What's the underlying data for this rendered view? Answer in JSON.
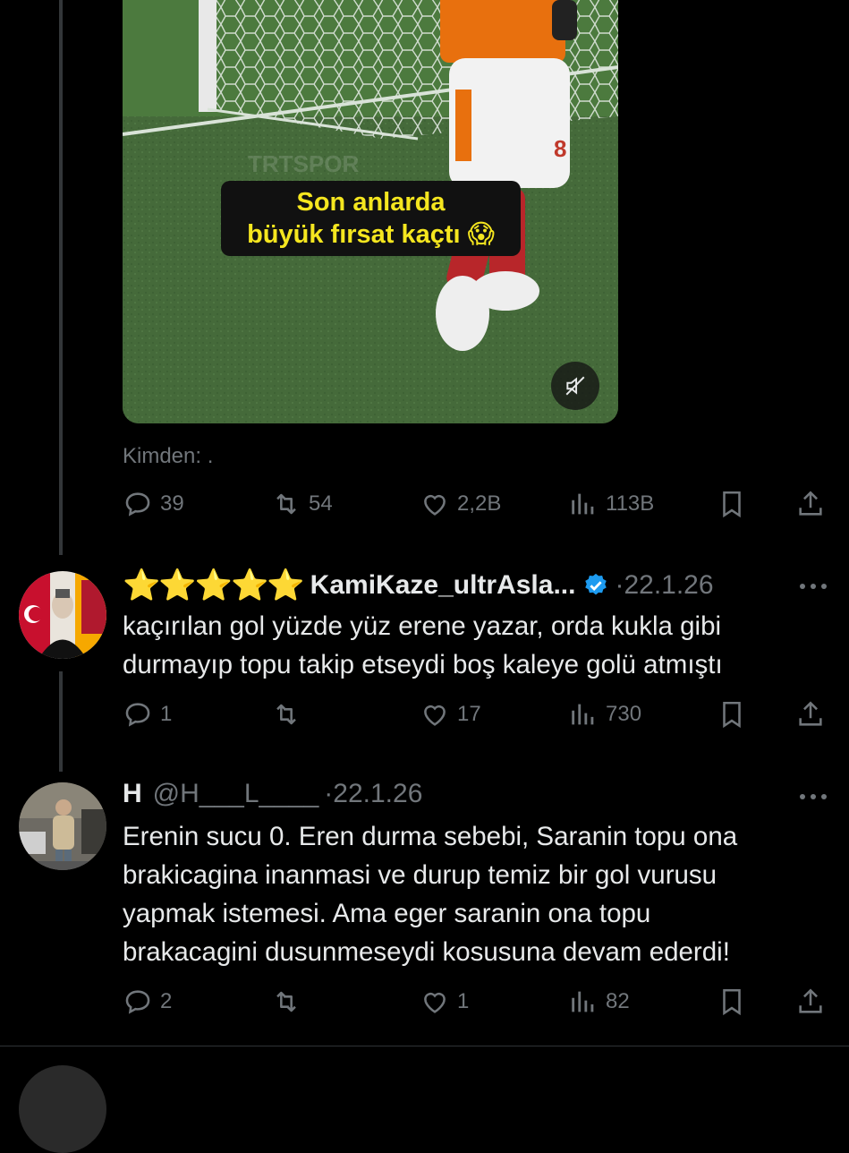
{
  "media": {
    "caption_line1": "Son anlarda",
    "caption_line2": "büyük fırsat kaçtı",
    "caption_emoji": "😱",
    "watermark": "TRTSPOR",
    "jersey_number": "8"
  },
  "main_tweet": {
    "source_label": "Kimden: .",
    "replies": "39",
    "reposts": "54",
    "likes": "2,2B",
    "views": "113B"
  },
  "reply1": {
    "stars": "⭐⭐⭐⭐⭐",
    "name": "KamiKaze_ultrAsla...",
    "dot": "·",
    "date": "22.1.26",
    "text_line1": "kaçırılan gol yüzde yüz erene yazar, orda kukla gibi",
    "text_line2": "durmayıp topu takip etseydi boş kaleye golü atmıştı",
    "replies": "1",
    "reposts": "",
    "likes": "17",
    "views": "730"
  },
  "reply2": {
    "name": "H",
    "handle": "@H___L____",
    "dot": "·",
    "date": "22.1.26",
    "text_line1": "Erenin sucu 0. Eren durma sebebi, Saranin topu ona",
    "text_line2": "brakicagina inanmasi ve durup temiz bir gol vurusu",
    "text_line3": "yapmak istemesi. Ama eger saranin ona topu",
    "text_line4": "brakacagini dusunmeseydi kosusuna devam ederdi!",
    "replies": "2",
    "reposts": "",
    "likes": "1",
    "views": "82"
  },
  "colors": {
    "background": "#000000",
    "text": "#e7e9ea",
    "muted": "#71767b",
    "verified": "#1d9bf0",
    "caption": "#f5e61f"
  }
}
